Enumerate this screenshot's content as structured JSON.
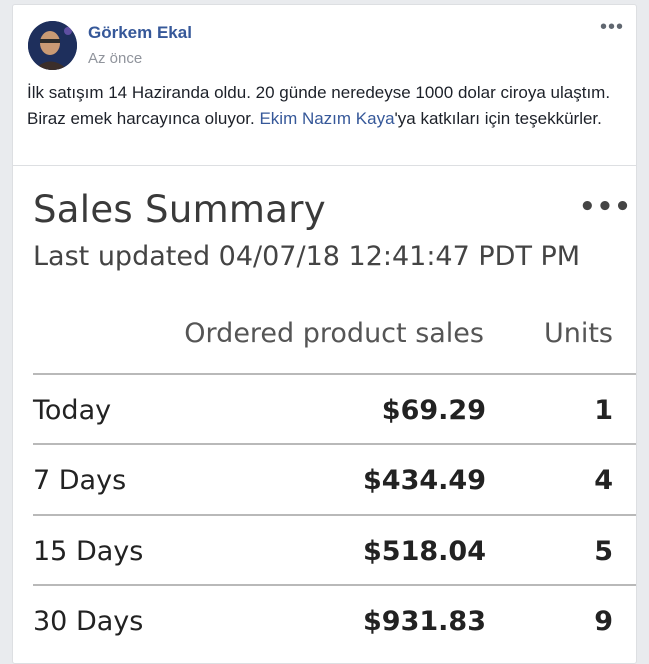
{
  "post": {
    "author": "Görkem Ekal",
    "time": "Az önce",
    "menu_glyph": "•••",
    "text_part1": "İlk satışım 14 Haziranda oldu. 20 günde neredeyse 1000 dolar ciroya ulaştım. Biraz emek harcayınca oluyor. ",
    "mention": "Ekim Nazım Kaya",
    "text_part2": "'ya katkıları için teşekkürler."
  },
  "sales_summary": {
    "title": "Sales Summary",
    "menu_glyph": "•••",
    "updated": "Last updated 04/07/18 12:41:47 PDT PM",
    "columns": {
      "sales": "Ordered product sales",
      "units": "Units"
    },
    "rows": [
      {
        "label": "Today",
        "sales": "$69.29",
        "units": "1"
      },
      {
        "label": "7 Days",
        "sales": "$434.49",
        "units": "4"
      },
      {
        "label": "15 Days",
        "sales": "$518.04",
        "units": "5"
      },
      {
        "label": "30 Days",
        "sales": "$931.83",
        "units": "9"
      }
    ]
  },
  "colors": {
    "link": "#365899",
    "background": "#e9ebee"
  }
}
